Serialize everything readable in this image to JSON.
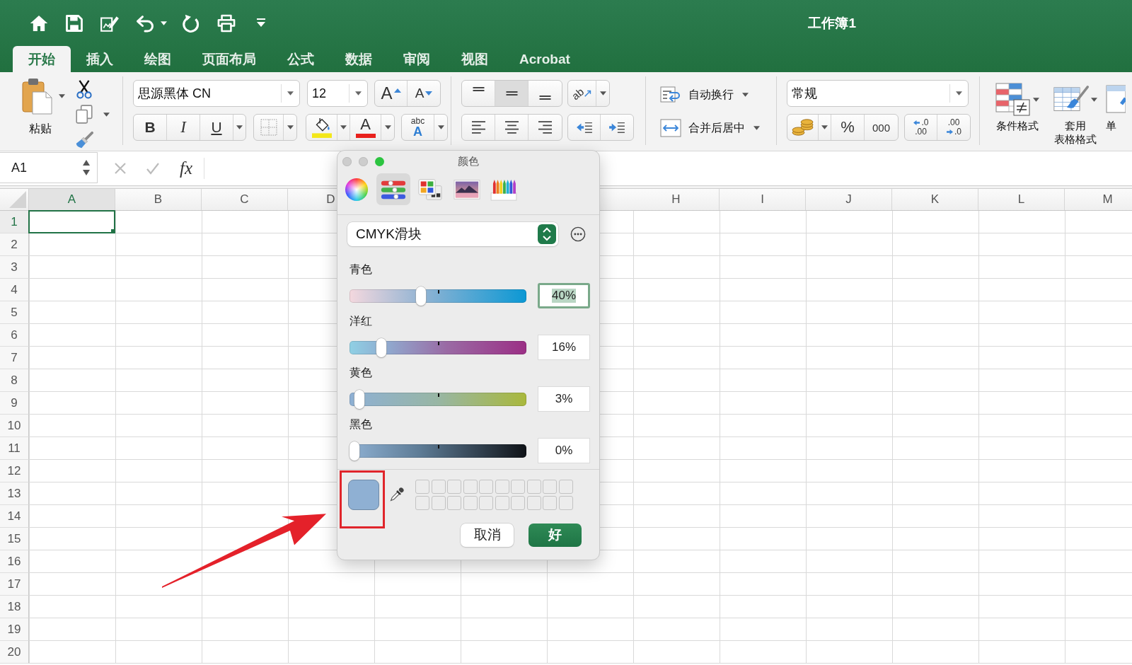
{
  "title_bar": {
    "title": "工作簿1"
  },
  "tabs": [
    {
      "label": "开始",
      "selected": true
    },
    {
      "label": "插入",
      "selected": false
    },
    {
      "label": "绘图",
      "selected": false
    },
    {
      "label": "页面布局",
      "selected": false
    },
    {
      "label": "公式",
      "selected": false
    },
    {
      "label": "数据",
      "selected": false
    },
    {
      "label": "审阅",
      "selected": false
    },
    {
      "label": "视图",
      "selected": false
    },
    {
      "label": "Acrobat",
      "selected": false
    }
  ],
  "ribbon": {
    "clipboard": {
      "paste_label": "粘贴"
    },
    "font": {
      "name": "思源黑体 CN",
      "size": "12",
      "size_buttons": [
        {
          "kind": "grow",
          "label": "A"
        },
        {
          "kind": "shrink",
          "label": "A"
        }
      ],
      "style_buttons": [
        {
          "kind": "bold",
          "label": "B"
        },
        {
          "kind": "italic",
          "label": "I"
        },
        {
          "kind": "underline",
          "label": "U"
        }
      ],
      "font_color_label": "A",
      "effects_label": {
        "top": "abc",
        "bottom": "A"
      }
    },
    "alignment": {
      "vertical": [
        {
          "kind": "top",
          "selected": false
        },
        {
          "kind": "middle",
          "selected": true
        },
        {
          "kind": "bottom",
          "selected": false
        }
      ],
      "horizontal": [
        {
          "kind": "left",
          "selected": false
        },
        {
          "kind": "center",
          "selected": false
        },
        {
          "kind": "right",
          "selected": false
        }
      ],
      "orientation_label": "ab"
    },
    "wrap": {
      "wrap_label": "自动换行",
      "merge_label": "合并后居中"
    },
    "number": {
      "format": "常规",
      "percent": "%",
      "thousands": "000",
      "decimals": [
        {
          "kind": "increase",
          "top": ".0",
          "bottom": ".00"
        },
        {
          "kind": "decrease",
          "top": ".00",
          "bottom": ".0"
        }
      ]
    },
    "styles": [
      {
        "kind": "conditional",
        "lines": [
          "条件格式"
        ]
      },
      {
        "kind": "table",
        "lines": [
          "套用",
          "表格格式"
        ]
      },
      {
        "kind": "cell",
        "lines": [
          "单"
        ]
      }
    ]
  },
  "formula_bar": {
    "name_box": "A1",
    "function_label": "fx"
  },
  "sheet": {
    "columns_left": [
      {
        "label": "A",
        "selected": true
      },
      {
        "label": "B",
        "selected": false
      },
      {
        "label": "C",
        "selected": false
      },
      {
        "label": "D",
        "selected": false
      }
    ],
    "columns_right": [
      {
        "label": "H",
        "selected": false
      },
      {
        "label": "I",
        "selected": false
      },
      {
        "label": "J",
        "selected": false
      },
      {
        "label": "K",
        "selected": false
      },
      {
        "label": "L",
        "selected": false
      },
      {
        "label": "M",
        "selected": false
      }
    ],
    "rows": [
      {
        "label": "1",
        "selected": true
      },
      {
        "label": "2",
        "selected": false
      },
      {
        "label": "3",
        "selected": false
      },
      {
        "label": "4",
        "selected": false
      },
      {
        "label": "5",
        "selected": false
      },
      {
        "label": "6",
        "selected": false
      },
      {
        "label": "7",
        "selected": false
      },
      {
        "label": "8",
        "selected": false
      },
      {
        "label": "9",
        "selected": false
      },
      {
        "label": "10",
        "selected": false
      },
      {
        "label": "11",
        "selected": false
      },
      {
        "label": "12",
        "selected": false
      },
      {
        "label": "13",
        "selected": false
      },
      {
        "label": "14",
        "selected": false
      },
      {
        "label": "15",
        "selected": false
      },
      {
        "label": "16",
        "selected": false
      },
      {
        "label": "17",
        "selected": false
      },
      {
        "label": "18",
        "selected": false
      },
      {
        "label": "19",
        "selected": false
      },
      {
        "label": "20",
        "selected": false
      }
    ]
  },
  "color_dialog": {
    "title": "颜色",
    "modes": [
      {
        "kind": "wheel",
        "selected": false
      },
      {
        "kind": "sliders",
        "selected": true
      },
      {
        "kind": "palettes",
        "selected": false
      },
      {
        "kind": "image",
        "selected": false
      },
      {
        "kind": "pencils",
        "selected": false
      }
    ],
    "slider_type": "CMYK滑块",
    "channels": [
      {
        "kind": "cyan",
        "name": "青色",
        "level": 0.4,
        "value": "40%",
        "focused": true
      },
      {
        "kind": "magenta",
        "name": "洋红",
        "level": 0.16,
        "value": "16%",
        "focused": false
      },
      {
        "kind": "yellow",
        "name": "黄色",
        "level": 0.03,
        "value": "3%",
        "focused": false
      },
      {
        "kind": "black",
        "name": "黑色",
        "level": 0,
        "value": "0%",
        "focused": false
      }
    ],
    "color_well": {
      "color": "#8fb0d3"
    },
    "buttons": [
      {
        "kind": "cancel",
        "label": "取消"
      },
      {
        "kind": "ok",
        "label": "好"
      }
    ]
  }
}
